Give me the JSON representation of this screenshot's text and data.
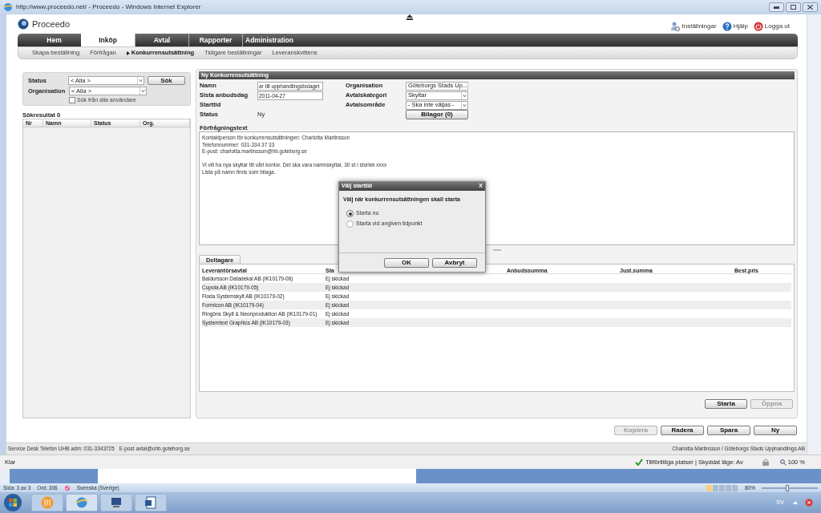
{
  "window": {
    "title": "http://www.proceedo.net/ - Proceedo - Windows Internet Explorer"
  },
  "app": {
    "logo": "Proceedo",
    "top_links": [
      {
        "kind": "settings",
        "label": "Inställningar"
      },
      {
        "kind": "help",
        "label": "Hjälp"
      },
      {
        "kind": "logout",
        "label": "Logga ut"
      }
    ]
  },
  "tabs": [
    {
      "label": "Hem",
      "selected": false
    },
    {
      "label": "Inköp",
      "selected": true
    },
    {
      "label": "Avtal",
      "selected": false
    },
    {
      "label": "Rapporter",
      "selected": false
    },
    {
      "label": "Administration",
      "selected": false
    }
  ],
  "subnav": [
    {
      "label": "Skapa beställning",
      "selected": false
    },
    {
      "label": "Förfrågan",
      "selected": false
    },
    {
      "label": "Konkurrensutsättning",
      "selected": true
    },
    {
      "label": "Tidigare beställningar",
      "selected": false
    },
    {
      "label": "Leveranskvittens",
      "selected": false
    }
  ],
  "search": {
    "fields": [
      {
        "label": "Status",
        "value": "< Alla >"
      },
      {
        "label": "Organisation",
        "value": "< Alla >"
      }
    ],
    "button": "Sök",
    "checkbox": {
      "label": "Sök från alla användare",
      "checked": false
    },
    "results_title": "Sökresultat 0",
    "columns": [
      "Nr",
      "Namn",
      "Status",
      "Org."
    ]
  },
  "form": {
    "title": "Ny Konkurrensutsättning",
    "left_fields": [
      {
        "label": "Namn",
        "kind": "input",
        "value": "ar till upphandlingsbolaget"
      },
      {
        "label": "Sista anbudsdag",
        "kind": "input",
        "value": "2011-04-27"
      },
      {
        "label": "Starttid",
        "kind": "text"
      },
      {
        "label": "Status",
        "kind": "text",
        "value": "Ny"
      }
    ],
    "right_fields": [
      {
        "label": "Organisation",
        "value": "Göteborgs Stads Up..."
      },
      {
        "label": "Avtalskategori",
        "value": "Skyltar"
      },
      {
        "label": "Avtalsområde",
        "value": "- Ska inte väljas -"
      }
    ],
    "attachments_button": "Bilagor (0)",
    "text_label": "Förfrågningstext",
    "text": "Kontaktperson för konkurrensutsättningen: Charlotta Martinsson\nTelefonnummer: 031-334 37 33\nE-post: charlotta.martinsson@hb.goteborg.se\n\nVi vill ha nya skyltar till vårt kontor. Det ska vara namnskyltar, 30 st i storlek xxxx\nLista på namn finns som bilaga."
  },
  "participants": {
    "tab": "Deltagare",
    "columns": [
      "Leverantörsavtal",
      "Sta",
      "Anbudssumma",
      "Just.summa",
      "Best.pris"
    ],
    "rows": [
      [
        "Baldursson Datadekal AB (IK10179-06)",
        "Ej skickad"
      ],
      [
        "Cupola AB (IK10179-05)",
        "Ej skickad"
      ],
      [
        "Floda Systemskylt AB (IK10179-02)",
        "Ej skickad"
      ],
      [
        "Formicon AB (IK10179-04)",
        "Ej skickad"
      ],
      [
        "Ringöns Skylt & Neonproduktion AB (IK10179-01)",
        "Ej skickad"
      ],
      [
        "Systemtext Graphics AB (IK10179-03)",
        "Ej skickad"
      ]
    ]
  },
  "panel_buttons": [
    {
      "label": "Starta",
      "disabled": false
    },
    {
      "label": "Öppna",
      "disabled": true
    }
  ],
  "actions": [
    {
      "label": "Kopiera",
      "disabled": true
    },
    {
      "label": "Radera",
      "disabled": false
    },
    {
      "label": "Spara",
      "disabled": false
    },
    {
      "label": "Ny",
      "disabled": false
    }
  ],
  "footer": {
    "left": [
      "Service Desk Telefon UHB adm: 031-3343725",
      "E-post avtal@uhb.goteborg.se"
    ],
    "right": "Charlotta Martinsson / Göteborgs Stads Upphandlings AB"
  },
  "dialog": {
    "title": "Välj starttid",
    "close": "X",
    "heading": "Välj när konkurrensutsättningen skall starta",
    "options": [
      {
        "label": "Starta nu",
        "selected": true
      },
      {
        "label": "Starta vid angiven tidpunkt",
        "selected": false
      }
    ],
    "buttons": [
      "OK",
      "Avbryt"
    ]
  },
  "ie_status": {
    "text": "Klar",
    "zone": "Tillförlitliga platser | Skyddat läge: Av",
    "zoom": "100 %"
  },
  "word_status": {
    "page": "Sida: 3 av 3",
    "words": "Ord: 306",
    "language": "Svenska (Sverige)",
    "zoom": "80%",
    "zoom_slider": {
      "level": 0.45
    }
  },
  "taskbar": {
    "language": "SV"
  }
}
